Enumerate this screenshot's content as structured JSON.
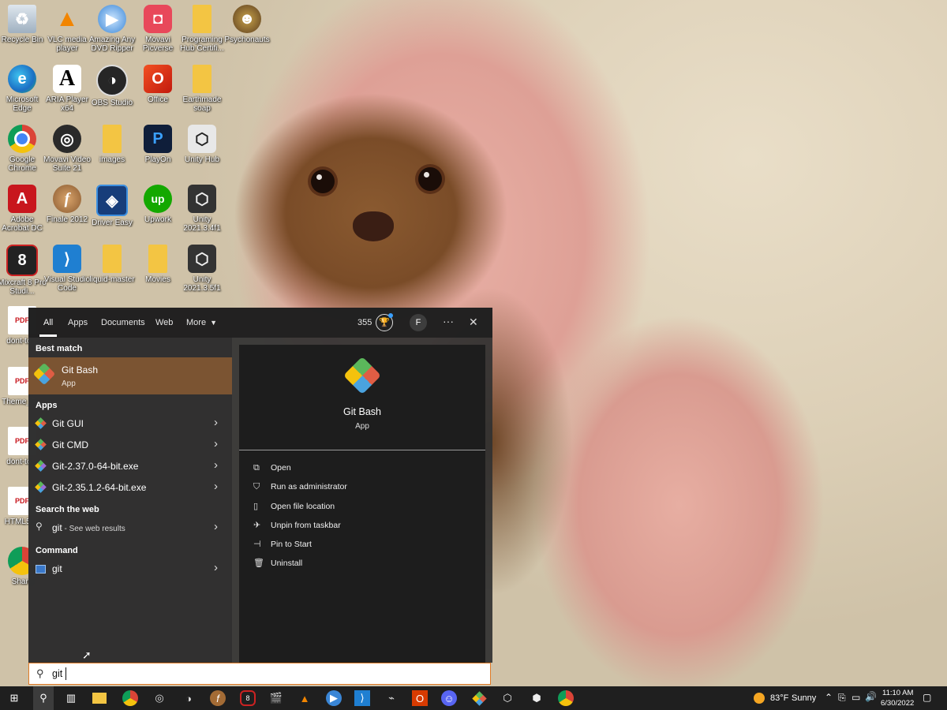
{
  "desktop": {
    "icons": [
      {
        "label": "Recycle Bin",
        "icon": "recycle-bin-icon"
      },
      {
        "label": "VLC media player",
        "icon": "vlc-icon"
      },
      {
        "label": "Amazing Any DVD Ripper",
        "icon": "dvd-ripper-icon"
      },
      {
        "label": "Movavi Picverse",
        "icon": "movavi-picverse-icon"
      },
      {
        "label": "Programing Hub Certifi...",
        "icon": "folder-icon"
      },
      {
        "label": "Psychonauts",
        "icon": "psychonauts-icon"
      },
      {
        "label": "Microsoft Edge",
        "icon": "edge-icon"
      },
      {
        "label": "ARIA Player x64",
        "icon": "aria-player-icon"
      },
      {
        "label": "OBS Studio",
        "icon": "obs-icon"
      },
      {
        "label": "Office",
        "icon": "office-icon"
      },
      {
        "label": "Earthmade soap",
        "icon": "folder-icon"
      },
      {
        "label": "Google Chrome",
        "icon": "chrome-icon"
      },
      {
        "label": "Movavi Video Suite 21",
        "icon": "movavi-video-icon"
      },
      {
        "label": "images",
        "icon": "folder-icon"
      },
      {
        "label": "PlayOn",
        "icon": "playon-icon"
      },
      {
        "label": "Unity Hub",
        "icon": "unity-hub-icon"
      },
      {
        "label": "Adobe Acrobat DC",
        "icon": "acrobat-icon"
      },
      {
        "label": "Finale 2012",
        "icon": "finale-icon"
      },
      {
        "label": "Driver Easy",
        "icon": "driver-easy-icon"
      },
      {
        "label": "Upwork",
        "icon": "upwork-icon"
      },
      {
        "label": "Unity 2021.3.4f1",
        "icon": "unity-icon"
      },
      {
        "label": "Mixcraft 8 Pro Studi...",
        "icon": "mixcraft-icon"
      },
      {
        "label": "Visual Studio Code",
        "icon": "vscode-icon"
      },
      {
        "label": "liquid-master",
        "icon": "folder-icon"
      },
      {
        "label": "Movies",
        "icon": "folder-icon"
      },
      {
        "label": "Unity 2021.3.5f1",
        "icon": "unity-icon"
      },
      {
        "label": "dont-to...",
        "icon": "pdf-icon"
      },
      {
        "label": "Theme_S...",
        "icon": "pdf-icon"
      },
      {
        "label": "dont-to...",
        "icon": "pdf-icon"
      },
      {
        "label": "HTML5-...",
        "icon": "pdf-icon"
      },
      {
        "label": "Share",
        "icon": "share-icon"
      }
    ]
  },
  "search_panel": {
    "tabs": [
      "All",
      "Apps",
      "Documents",
      "Web",
      "More"
    ],
    "points": "355",
    "avatar_letter": "F",
    "more_options": "···",
    "close": "✕",
    "best_match_header": "Best match",
    "best_match": {
      "name": "Git Bash",
      "type": "App"
    },
    "apps_header": "Apps",
    "apps": [
      "Git GUI",
      "Git CMD",
      "Git-2.37.0-64-bit.exe",
      "Git-2.35.1.2-64-bit.exe"
    ],
    "web_header": "Search the web",
    "web_result": {
      "query": "git",
      "suffix": " - See web results"
    },
    "command_header": "Command",
    "command": "git",
    "preview": {
      "name": "Git Bash",
      "type": "App"
    },
    "actions": [
      {
        "label": "Open",
        "icon": "open-icon"
      },
      {
        "label": "Run as administrator",
        "icon": "admin-icon"
      },
      {
        "label": "Open file location",
        "icon": "file-location-icon"
      },
      {
        "label": "Unpin from taskbar",
        "icon": "unpin-icon"
      },
      {
        "label": "Pin to Start",
        "icon": "pin-icon"
      },
      {
        "label": "Uninstall",
        "icon": "trash-icon"
      }
    ],
    "search_value": "git"
  },
  "taskbar": {
    "weather_temp": "83°F",
    "weather_text": "Sunny",
    "time": "11:10 AM",
    "date": "6/30/2022"
  },
  "colors": {
    "best_match_bg": "#7b5432",
    "search_border": "#e07b26",
    "taskbar_bg": "#1f1f1f"
  }
}
